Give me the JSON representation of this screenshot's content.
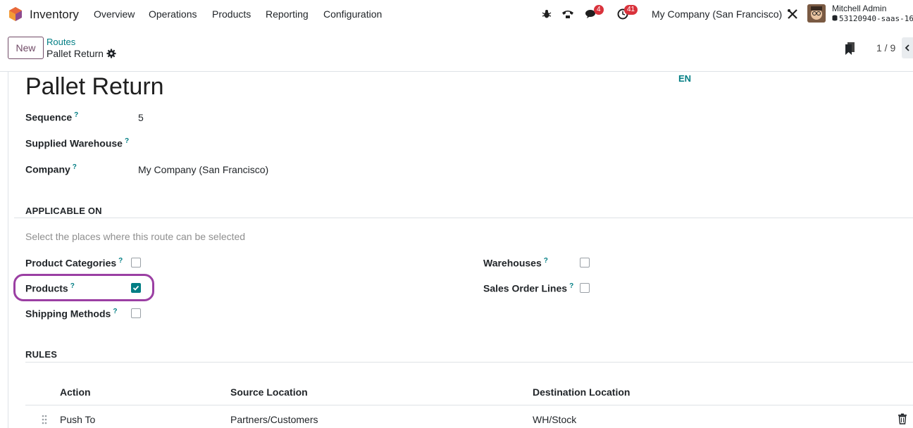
{
  "navbar": {
    "app_name": "Inventory",
    "menu": [
      "Overview",
      "Operations",
      "Products",
      "Reporting",
      "Configuration"
    ],
    "messages_badge": "4",
    "activities_badge": "41",
    "company": "My Company (San Francisco)",
    "user_name": "Mitchell Admin",
    "db_name": "53120940-saas-16"
  },
  "control_panel": {
    "new_label": "New",
    "breadcrumb_parent": "Routes",
    "breadcrumb_current": "Pallet Return",
    "pager": "1 / 9"
  },
  "form": {
    "title": "Pallet Return",
    "lang": "EN",
    "fields": {
      "sequence_label": "Sequence",
      "sequence_value": "5",
      "warehouse_label": "Supplied Warehouse",
      "warehouse_value": "",
      "company_label": "Company",
      "company_value": "My Company (San Francisco)"
    },
    "applicable_on": {
      "title": "APPLICABLE ON",
      "subtitle": "Select the places where this route can be selected",
      "product_categories": "Product Categories",
      "products": "Products",
      "shipping_methods": "Shipping Methods",
      "warehouses": "Warehouses",
      "sales_order_lines": "Sales Order Lines",
      "checked": {
        "product_categories": false,
        "products": true,
        "shipping_methods": false,
        "warehouses": false,
        "sales_order_lines": false
      }
    },
    "rules": {
      "title": "RULES",
      "columns": [
        "Action",
        "Source Location",
        "Destination Location"
      ],
      "rows": [
        {
          "action": "Push To",
          "source": "Partners/Customers",
          "destination": "WH/Stock"
        }
      ]
    }
  },
  "colors": {
    "brand": "#714b67",
    "accent": "#017e84",
    "badge": "#d9323b",
    "highlight": "#9b3fa3"
  }
}
